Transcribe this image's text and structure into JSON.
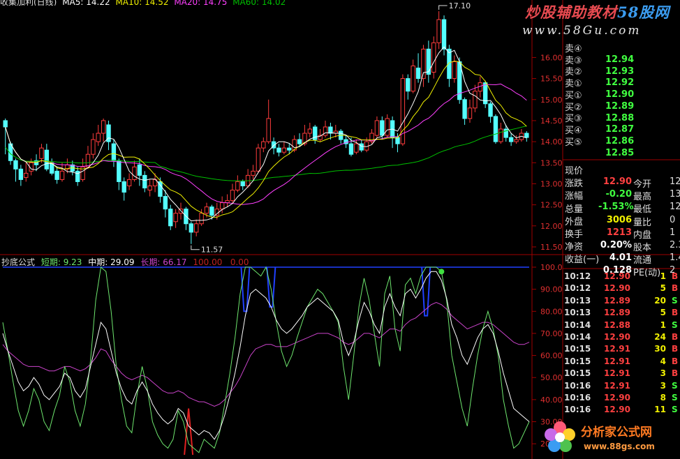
{
  "header": {
    "title_partial": "收集加利(日线)",
    "ma5": "MA5: 14.22",
    "ma10": "MA10: 14.52",
    "ma20": "MA20: 14.75",
    "ma60": "MA60: 14.02"
  },
  "watermark": {
    "top_text_red": "炒股辅助教材",
    "top_text_blue": "58股网",
    "top_url": "www.58Gu.com",
    "bottom_text": "分析家公式网",
    "bottom_url": "www.88gs.com"
  },
  "colors": {
    "up": "#ff3c3c",
    "down": "#54ffff",
    "ma5": "#ffffff",
    "ma10": "#f0f000",
    "ma20": "#ff40ff",
    "ma60": "#00c000",
    "short": "#6ee66e",
    "mid": "#ffffff",
    "long": "#cc44cc",
    "signal": "#2040ff"
  },
  "price_axis": {
    "labels": [
      "16.00",
      "15.50",
      "15.00",
      "14.50",
      "14.00",
      "13.50",
      "13.00",
      "12.50",
      "12.00",
      "11.50"
    ],
    "high_annotation": "17.10",
    "low_annotation": "11.57"
  },
  "indicator": {
    "name": "抄底公式",
    "short_label": "短期:",
    "short_value": "9.23",
    "mid_label": "中期:",
    "mid_value": "29.09",
    "long_label": "长期:",
    "long_value": "66.17",
    "extra": "100.00   0.00",
    "axis_labels": [
      "100.0",
      "90.00",
      "80.00",
      "70.00",
      "60.00",
      "50.00",
      "40.00",
      "30.00",
      "20.00"
    ]
  },
  "order_book": [
    {
      "label": "卖④",
      "price": "12.94",
      "vol": ""
    },
    {
      "label": "卖③",
      "price": "12.93",
      "vol": ""
    },
    {
      "label": "卖②",
      "price": "12.92",
      "vol": ""
    },
    {
      "label": "卖①",
      "price": "12.90",
      "vol": ""
    },
    {
      "label": "买①",
      "price": "12.89",
      "vol": ""
    },
    {
      "label": "买②",
      "price": "12.88",
      "vol": ""
    },
    {
      "label": "买③",
      "price": "12.87",
      "vol": ""
    },
    {
      "label": "买④",
      "price": "12.86",
      "vol": ""
    },
    {
      "label": "买⑤",
      "price": "12.85",
      "vol": ""
    }
  ],
  "quote": [
    {
      "l1": "现价",
      "v1": "12.90",
      "c1": "#ff4040",
      "l2": "今开",
      "v2": "12"
    },
    {
      "l1": "涨跌",
      "v1": "-0.20",
      "c1": "#40ff40",
      "l2": "最高",
      "v2": "13"
    },
    {
      "l1": "涨幅",
      "v1": "-1.53%",
      "c1": "#40ff40",
      "l2": "最低",
      "v2": "12"
    },
    {
      "l1": "总量",
      "v1": "3006",
      "c1": "#f0f000",
      "l2": "量比",
      "v2": "0"
    },
    {
      "l1": "外盘",
      "v1": "1213",
      "c1": "#ff4040",
      "l2": "内盘",
      "v2": "1"
    },
    {
      "l1": "换手",
      "v1": "0.20%",
      "c1": "#ffffff",
      "l2": "股本",
      "v2": "2.3"
    },
    {
      "l1": "净资",
      "v1": "4.01",
      "c1": "#ffffff",
      "l2": "流通",
      "v2": "1.4"
    },
    {
      "l1": "收益(一)",
      "v1": "0.128",
      "c1": "#ffffff",
      "l2": "PE(动)",
      "v2": "2"
    }
  ],
  "ticks": [
    {
      "time": "10:12",
      "price": "12.90",
      "vol": "1",
      "bs": "B"
    },
    {
      "time": "10:12",
      "price": "12.90",
      "vol": "5",
      "bs": "B"
    },
    {
      "time": "10:13",
      "price": "12.89",
      "vol": "20",
      "bs": "S"
    },
    {
      "time": "10:13",
      "price": "12.89",
      "vol": "5",
      "bs": "B"
    },
    {
      "time": "10:14",
      "price": "12.88",
      "vol": "1",
      "bs": "S"
    },
    {
      "time": "10:14",
      "price": "12.90",
      "vol": "24",
      "bs": "B"
    },
    {
      "time": "10:15",
      "price": "12.91",
      "vol": "30",
      "bs": "B"
    },
    {
      "time": "10:15",
      "price": "12.91",
      "vol": "4",
      "bs": "B"
    },
    {
      "time": "10:15",
      "price": "12.91",
      "vol": "3",
      "bs": "B"
    },
    {
      "time": "10:16",
      "price": "12.91",
      "vol": "3",
      "bs": "S"
    },
    {
      "time": "10:16",
      "price": "12.90",
      "vol": "8",
      "bs": "S"
    },
    {
      "time": "10:16",
      "price": "12.90",
      "vol": "11",
      "bs": "S"
    }
  ],
  "chart_data": [
    {
      "type": "candlestick",
      "title": "",
      "ylim": [
        11.4,
        17.2
      ],
      "high_marker": 17.1,
      "low_marker": 11.57,
      "ohlc": [
        [
          14.5,
          14.35,
          14.55,
          13.7
        ],
        [
          13.95,
          13.55,
          14.0,
          13.45
        ],
        [
          13.55,
          13.35,
          13.6,
          13.05
        ],
        [
          13.35,
          13.1,
          13.45,
          12.95
        ],
        [
          13.15,
          13.25,
          13.5,
          13.05
        ],
        [
          13.3,
          13.5,
          13.6,
          13.2
        ],
        [
          13.55,
          13.45,
          13.7,
          13.3
        ],
        [
          13.6,
          13.85,
          13.95,
          13.5
        ],
        [
          13.8,
          13.35,
          13.95,
          13.3
        ],
        [
          13.5,
          13.25,
          13.6,
          13.2
        ],
        [
          13.3,
          13.1,
          13.4,
          13.0
        ],
        [
          13.1,
          13.3,
          13.5,
          13.05
        ],
        [
          13.35,
          13.45,
          13.6,
          13.25
        ],
        [
          13.45,
          13.3,
          13.55,
          13.2
        ],
        [
          13.3,
          13.05,
          13.4,
          12.95
        ],
        [
          13.1,
          13.4,
          13.6,
          13.05
        ],
        [
          13.4,
          13.7,
          13.9,
          13.35
        ],
        [
          13.7,
          14.05,
          14.2,
          13.6
        ],
        [
          14.0,
          14.2,
          14.4,
          13.9
        ],
        [
          14.2,
          14.5,
          14.55,
          14.0
        ],
        [
          14.4,
          14.0,
          14.5,
          13.8
        ],
        [
          13.95,
          13.55,
          14.05,
          13.4
        ],
        [
          13.55,
          13.05,
          13.6,
          12.85
        ],
        [
          13.05,
          12.8,
          13.15,
          12.6
        ],
        [
          12.95,
          13.1,
          13.25,
          12.85
        ],
        [
          13.1,
          13.4,
          13.55,
          13.05
        ],
        [
          13.45,
          13.2,
          13.6,
          12.95
        ],
        [
          13.2,
          12.9,
          13.3,
          12.8
        ],
        [
          12.85,
          12.95,
          13.1,
          12.7
        ],
        [
          12.95,
          13.1,
          13.25,
          12.8
        ],
        [
          13.05,
          12.7,
          13.15,
          12.55
        ],
        [
          12.7,
          12.4,
          12.85,
          12.2
        ],
        [
          12.4,
          12.0,
          12.5,
          11.9
        ],
        [
          12.1,
          12.3,
          12.4,
          11.95
        ],
        [
          12.3,
          12.4,
          12.55,
          12.15
        ],
        [
          12.4,
          12.05,
          12.45,
          11.9
        ],
        [
          12.05,
          11.85,
          12.1,
          11.57
        ],
        [
          11.85,
          12.05,
          12.15,
          11.75
        ],
        [
          12.05,
          12.3,
          12.4,
          12.0
        ],
        [
          12.3,
          12.45,
          12.55,
          12.2
        ],
        [
          12.45,
          12.25,
          12.5,
          12.15
        ],
        [
          12.25,
          12.4,
          12.55,
          12.15
        ],
        [
          12.4,
          12.55,
          12.7,
          12.3
        ],
        [
          12.55,
          12.6,
          12.75,
          12.45
        ],
        [
          12.6,
          12.85,
          13.0,
          12.55
        ],
        [
          12.85,
          13.05,
          13.2,
          12.8
        ],
        [
          13.05,
          12.95,
          13.1,
          12.85
        ],
        [
          12.95,
          13.2,
          13.35,
          12.9
        ],
        [
          13.2,
          13.3,
          13.45,
          13.1
        ],
        [
          13.3,
          13.85,
          13.95,
          13.25
        ],
        [
          13.85,
          14.0,
          14.1,
          13.75
        ],
        [
          14.0,
          14.55,
          15.0,
          13.95
        ],
        [
          14.0,
          13.85,
          14.1,
          13.7
        ],
        [
          13.85,
          13.75,
          13.95,
          13.65
        ],
        [
          13.75,
          13.85,
          14.0,
          13.7
        ],
        [
          13.85,
          13.8,
          13.95,
          13.7
        ],
        [
          13.8,
          14.05,
          14.15,
          13.75
        ],
        [
          14.05,
          13.95,
          14.2,
          13.9
        ],
        [
          13.95,
          14.2,
          14.4,
          13.9
        ],
        [
          14.2,
          14.3,
          14.45,
          14.1
        ],
        [
          14.35,
          14.05,
          14.4,
          13.95
        ],
        [
          14.05,
          14.15,
          14.3,
          14.0
        ],
        [
          14.15,
          14.35,
          14.5,
          14.1
        ],
        [
          14.35,
          14.2,
          14.45,
          14.05
        ],
        [
          14.2,
          14.25,
          14.4,
          14.1
        ],
        [
          14.25,
          14.05,
          14.3,
          13.95
        ],
        [
          14.05,
          13.95,
          14.15,
          13.85
        ],
        [
          13.95,
          13.7,
          14.1,
          13.65
        ],
        [
          13.75,
          13.95,
          14.05,
          13.7
        ],
        [
          13.95,
          13.8,
          14.05,
          13.75
        ],
        [
          13.8,
          14.0,
          14.1,
          13.75
        ],
        [
          14.0,
          14.2,
          14.3,
          13.95
        ],
        [
          14.15,
          14.5,
          14.6,
          14.1
        ],
        [
          14.5,
          14.15,
          14.6,
          14.05
        ],
        [
          14.15,
          14.55,
          14.65,
          14.1
        ],
        [
          14.5,
          14.1,
          14.6,
          13.85
        ],
        [
          14.1,
          13.95,
          14.2,
          13.75
        ],
        [
          13.95,
          15.5,
          15.6,
          13.9
        ],
        [
          15.5,
          15.2,
          15.6,
          15.0
        ],
        [
          15.2,
          15.8,
          15.95,
          15.15
        ],
        [
          15.75,
          15.5,
          16.1,
          15.4
        ],
        [
          15.5,
          16.2,
          16.3,
          15.3
        ],
        [
          16.2,
          15.6,
          16.4,
          15.4
        ],
        [
          15.65,
          16.35,
          16.5,
          15.5
        ],
        [
          16.35,
          16.9,
          17.1,
          16.2
        ],
        [
          16.9,
          16.2,
          17.0,
          16.05
        ],
        [
          16.2,
          15.5,
          16.3,
          15.3
        ],
        [
          15.5,
          15.9,
          16.05,
          15.4
        ],
        [
          15.9,
          15.0,
          16.0,
          14.9
        ],
        [
          15.0,
          14.55,
          15.05,
          14.4
        ],
        [
          14.55,
          14.8,
          15.0,
          14.45
        ],
        [
          14.8,
          15.2,
          15.35,
          14.7
        ],
        [
          15.2,
          15.4,
          15.55,
          15.05
        ],
        [
          15.4,
          14.9,
          15.45,
          14.8
        ],
        [
          14.9,
          14.6,
          14.95,
          14.45
        ],
        [
          14.6,
          14.0,
          14.65,
          13.95
        ],
        [
          14.0,
          14.3,
          14.45,
          13.95
        ],
        [
          14.3,
          14.1,
          14.4,
          14.0
        ],
        [
          14.1,
          14.0,
          14.2,
          13.9
        ],
        [
          14.0,
          14.05,
          14.15,
          13.95
        ],
        [
          14.05,
          14.2,
          14.3,
          14.0
        ],
        [
          14.2,
          14.1,
          14.25,
          14.0
        ]
      ]
    },
    {
      "type": "line",
      "title": "",
      "ylim": [
        15,
        100
      ],
      "series": [
        {
          "name": "短期",
          "values": [
            75,
            62,
            48,
            35,
            28,
            35,
            45,
            40,
            30,
            26,
            35,
            42,
            55,
            48,
            35,
            28,
            38,
            58,
            85,
            100,
            98,
            80,
            55,
            40,
            28,
            25,
            42,
            55,
            45,
            30,
            24,
            20,
            18,
            22,
            35,
            30,
            20,
            18,
            16,
            22,
            20,
            18,
            25,
            38,
            52,
            68,
            88,
            100,
            100,
            98,
            96,
            100,
            90,
            75,
            62,
            55,
            60,
            68,
            75,
            82,
            86,
            90,
            88,
            84,
            80,
            75,
            55,
            40,
            60,
            82,
            95,
            85,
            70,
            55,
            88,
            96,
            72,
            62,
            92,
            95,
            88,
            96,
            100,
            100,
            100,
            98,
            85,
            60,
            48,
            36,
            28,
            45,
            60,
            72,
            80,
            72,
            60,
            40,
            28,
            18,
            20,
            25,
            30
          ]
        },
        {
          "name": "中期",
          "values": [
            70,
            62,
            55,
            48,
            44,
            46,
            50,
            47,
            42,
            40,
            43,
            46,
            52,
            50,
            44,
            41,
            45,
            55,
            65,
            75,
            72,
            62,
            52,
            45,
            40,
            38,
            44,
            48,
            44,
            38,
            34,
            31,
            29,
            31,
            36,
            34,
            28,
            26,
            24,
            26,
            25,
            22,
            26,
            33,
            42,
            52,
            64,
            78,
            88,
            90,
            88,
            86,
            82,
            76,
            72,
            70,
            72,
            75,
            78,
            82,
            84,
            86,
            84,
            82,
            80,
            76,
            66,
            60,
            66,
            76,
            84,
            80,
            74,
            70,
            82,
            88,
            82,
            78,
            88,
            90,
            86,
            90,
            95,
            98,
            98,
            94,
            86,
            74,
            68,
            60,
            56,
            62,
            68,
            72,
            74,
            70,
            62,
            52,
            44,
            36,
            34,
            32,
            30
          ]
        },
        {
          "name": "长期",
          "values": [
            65,
            62,
            60,
            58,
            56,
            55,
            55,
            55,
            54,
            53,
            53,
            54,
            55,
            55,
            54,
            53,
            54,
            56,
            59,
            63,
            62,
            58,
            55,
            52,
            50,
            49,
            50,
            51,
            50,
            48,
            46,
            44,
            43,
            43,
            44,
            43,
            41,
            40,
            39,
            39,
            38,
            37,
            38,
            40,
            43,
            46,
            50,
            55,
            60,
            63,
            64,
            65,
            65,
            64,
            64,
            64,
            65,
            66,
            67,
            68,
            69,
            70,
            70,
            70,
            69,
            68,
            66,
            65,
            66,
            68,
            70,
            70,
            69,
            68,
            70,
            72,
            72,
            71,
            74,
            76,
            77,
            79,
            81,
            83,
            84,
            83,
            81,
            78,
            76,
            74,
            72,
            73,
            74,
            75,
            75,
            74,
            72,
            70,
            68,
            66,
            65,
            65,
            66
          ]
        }
      ]
    }
  ]
}
